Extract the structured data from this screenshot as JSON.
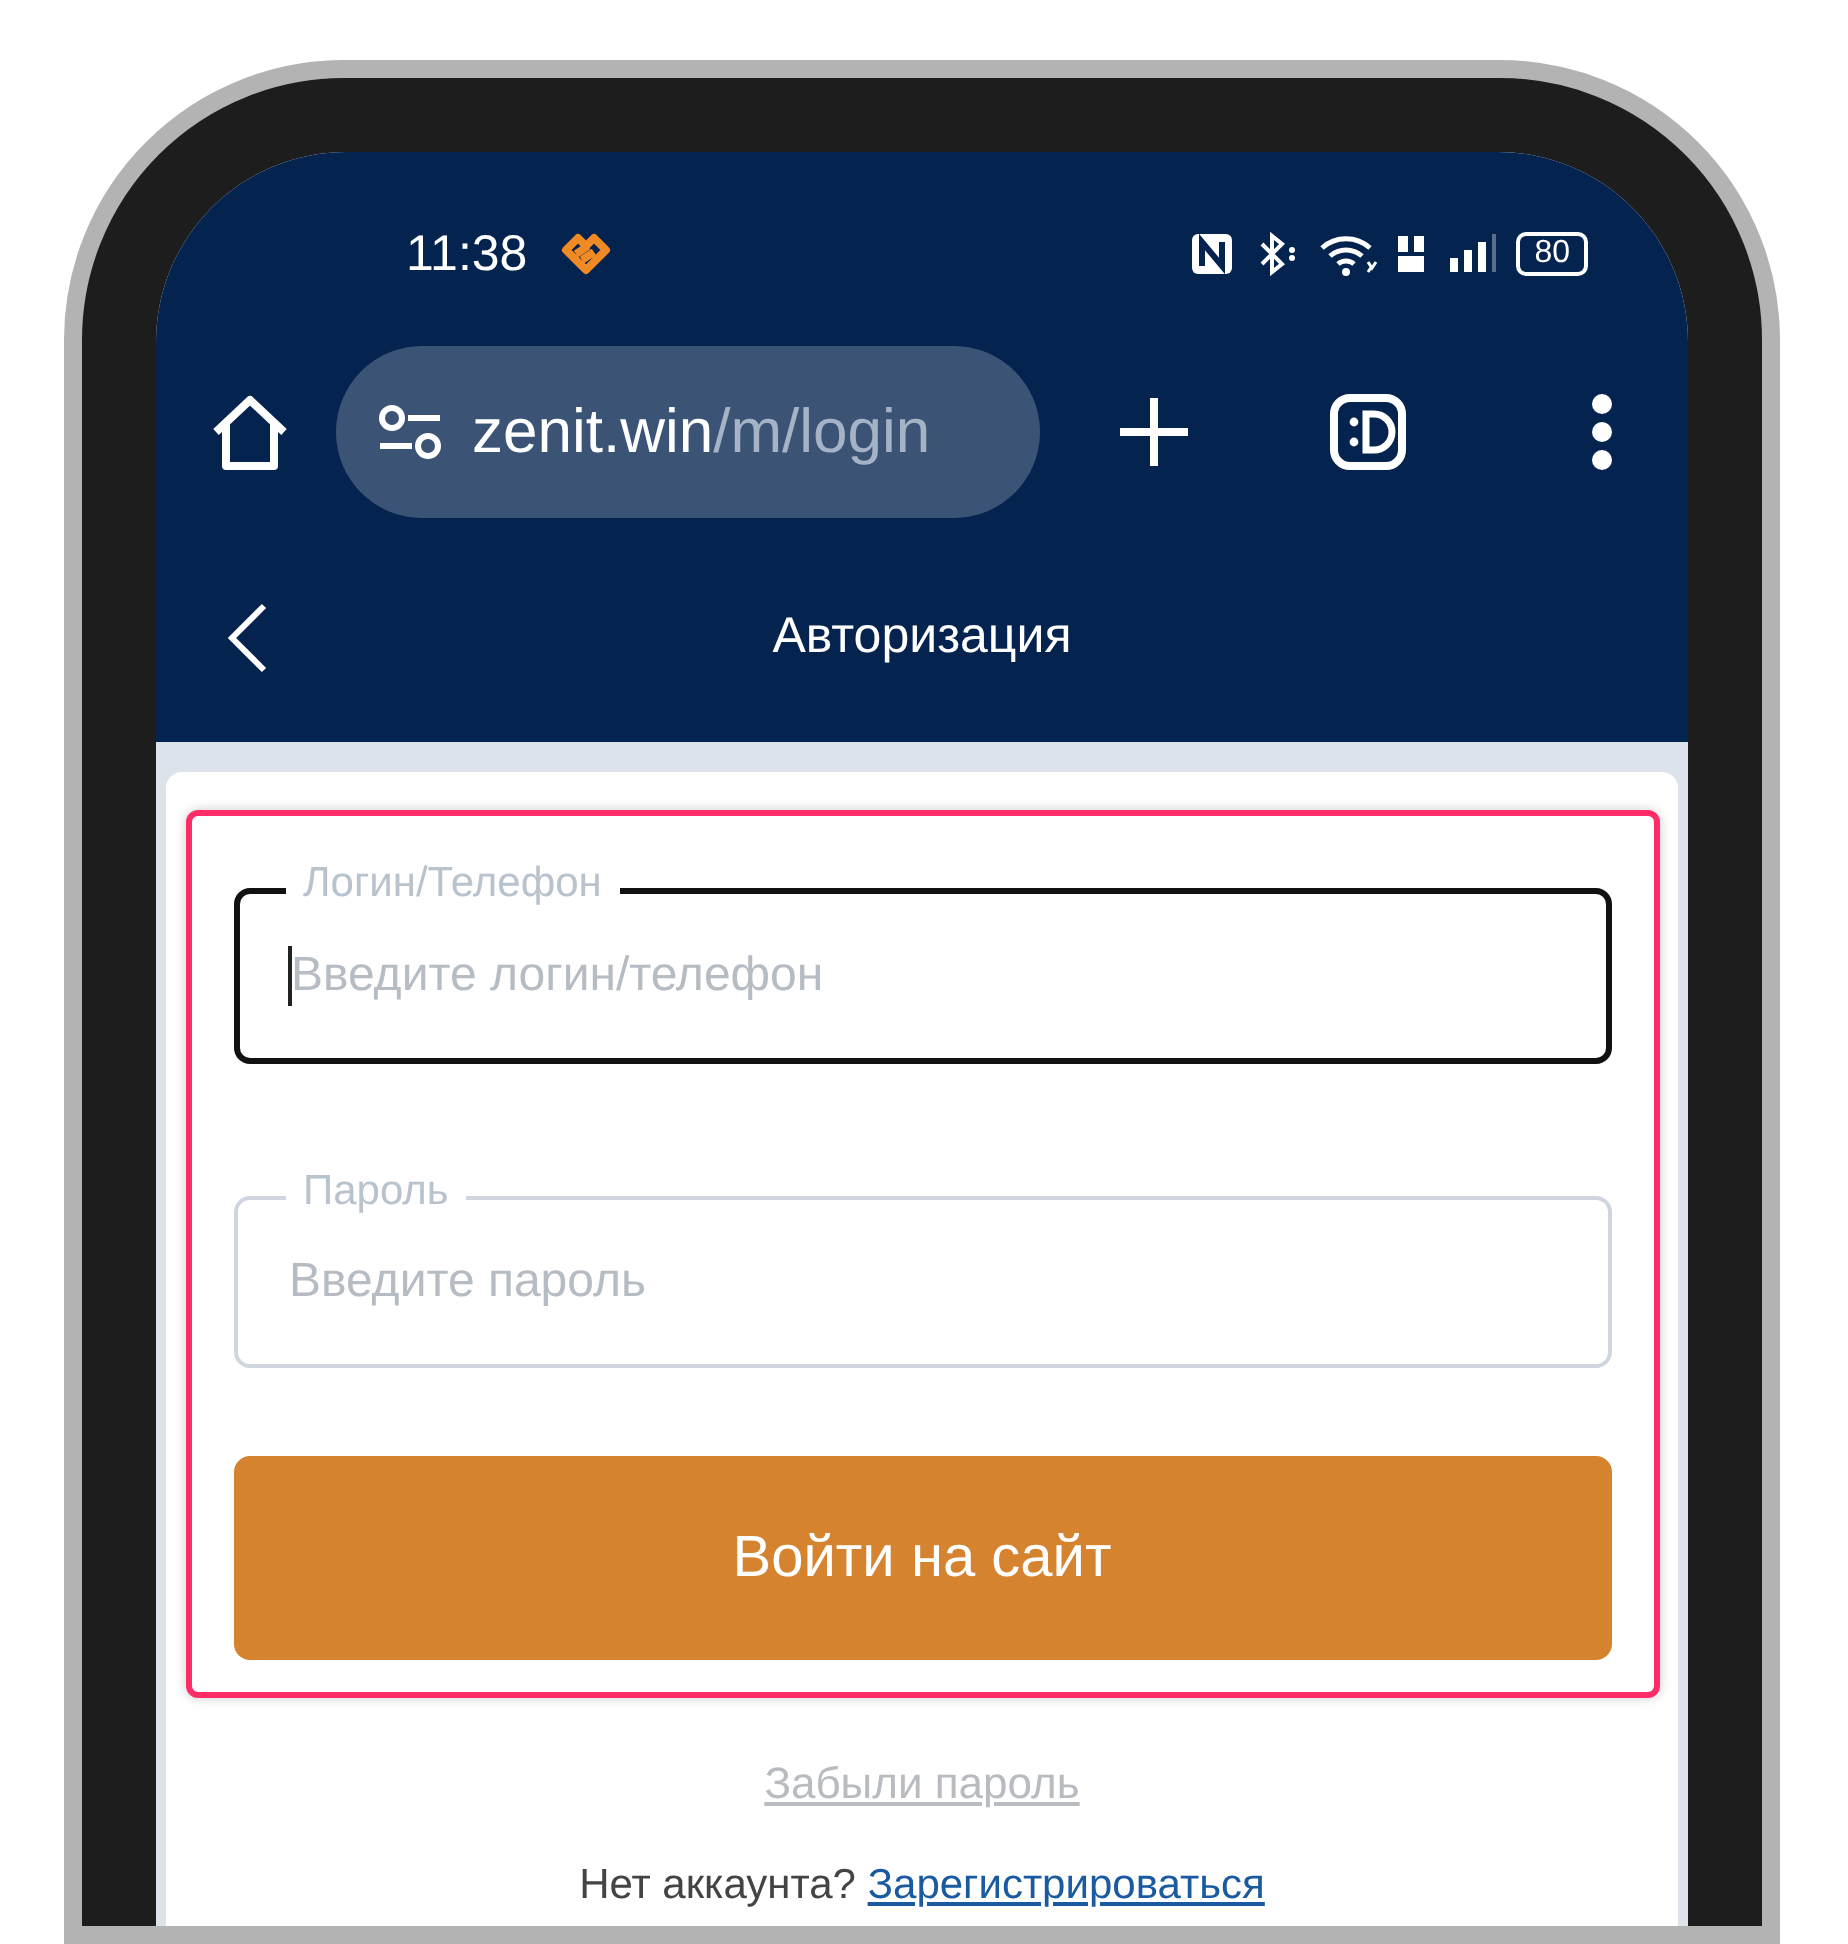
{
  "status_bar": {
    "time": "11:38",
    "battery": "80"
  },
  "address_bar": {
    "domain": "zenit.win",
    "path": "/m/login"
  },
  "header": {
    "title": "Авторизация"
  },
  "form": {
    "highlighted": true,
    "fields": [
      {
        "label": "Логин/Телефон",
        "placeholder": "Введите логин/телефон",
        "focused": true
      },
      {
        "label": "Пароль",
        "placeholder": "Введите пароль",
        "focused": false
      }
    ],
    "submit": "Войти на сайт"
  },
  "forgot_link": "Забыли пароль",
  "signup": {
    "prompt": "Нет аккаунта?",
    "link": "Зарегистрироваться"
  }
}
